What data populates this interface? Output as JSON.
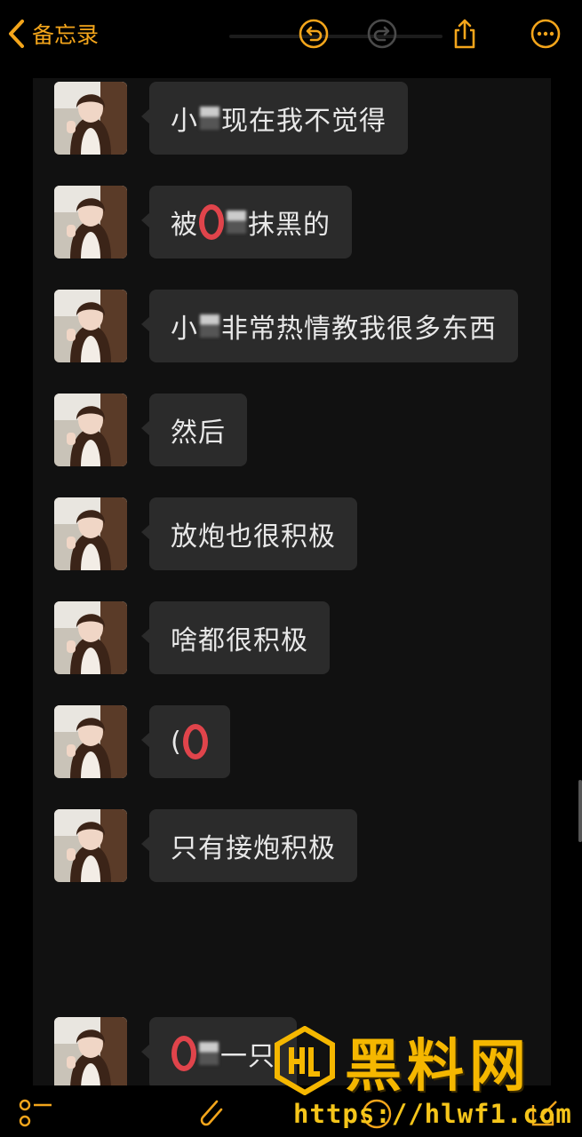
{
  "topbar": {
    "back_label": "备忘录",
    "accent": "#f3a51b"
  },
  "messages": [
    {
      "parts": [
        "小",
        "[redacted]",
        "现在我不觉得"
      ]
    },
    {
      "parts": [
        "被",
        "[red-mark]",
        "[redacted]",
        "抹黑的"
      ]
    },
    {
      "parts": [
        "小",
        "[redacted]",
        "非常热情教我很多东西"
      ]
    },
    {
      "parts": [
        "然后"
      ]
    },
    {
      "parts": [
        "放炮也很积极"
      ]
    },
    {
      "parts": [
        "啥都很积极"
      ]
    },
    {
      "parts": [
        "(",
        "[red-mark]"
      ]
    },
    {
      "parts": [
        "只有接炮积极"
      ]
    },
    {
      "parts": [
        "[red-mark]",
        "[redacted]",
        "一只"
      ]
    }
  ],
  "watermark": {
    "title": "黑料网",
    "url": "https://hlwf1.com",
    "color": "#f5b700"
  },
  "icons": {
    "back": "chevron-left-icon",
    "undo": "undo-icon",
    "redo": "redo-icon",
    "share": "share-icon",
    "more": "more-icon",
    "checklist": "checklist-icon",
    "attach": "paperclip-icon",
    "markup": "markup-icon",
    "compose": "compose-icon"
  }
}
